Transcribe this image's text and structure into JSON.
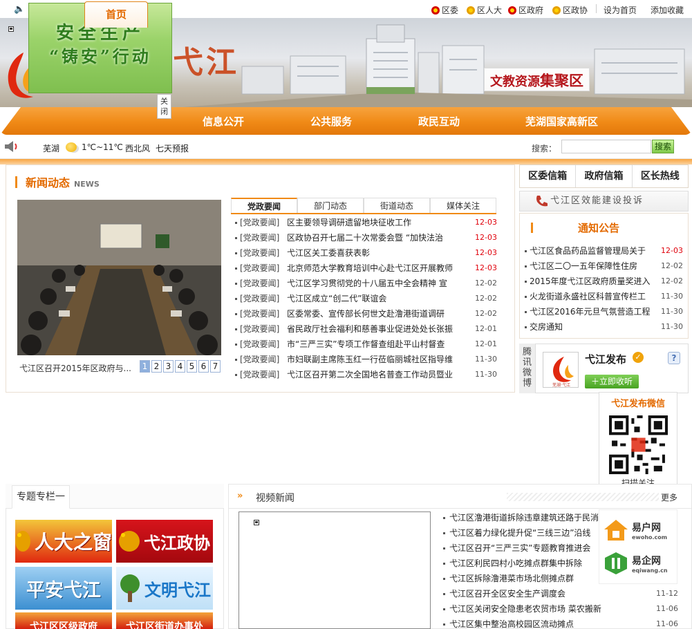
{
  "top_links": [
    {
      "label": "区委",
      "icon": "party-emblem-icon"
    },
    {
      "label": "区人大",
      "icon": "national-emblem-icon"
    },
    {
      "label": "区政府",
      "icon": "party-emblem-icon"
    },
    {
      "label": "区政协",
      "icon": "cppcc-emblem-icon"
    }
  ],
  "set_home_label": "设为首页",
  "add_favorite_label": "添加收藏",
  "banner": {
    "title_text": "弋江",
    "slogan_prefix": "文教资源",
    "slogan_highlight": "集聚区"
  },
  "float_ad": {
    "line1": "安全生产",
    "line2": "“铸安”行动",
    "close_label": "关闭"
  },
  "nav": {
    "home": "首页",
    "items": [
      "信息公开",
      "公共服务",
      "政民互动",
      "芜湖国家高新区"
    ]
  },
  "weather": {
    "city": "芜湖",
    "temp": "1℃~11℃",
    "wind": "西北风",
    "forecast_link": "七天预报"
  },
  "search": {
    "label": "搜索：",
    "button": "搜索",
    "value": ""
  },
  "news": {
    "title": "新闻动态",
    "subtitle": "NEWS",
    "photo_caption": "弋江区召开2015年区政府与...",
    "pages": [
      "1",
      "2",
      "3",
      "4",
      "5",
      "6",
      "7"
    ],
    "tabs": [
      "党政要闻",
      "部门动态",
      "街道动态",
      "媒体关注"
    ],
    "items": [
      {
        "cat": "[党政要闻]",
        "text": "区主要领导调研遗留地块征收工作",
        "date": "12-03",
        "red": true
      },
      {
        "cat": "[党政要闻]",
        "text": "区政协召开七届二十次常委会暨 “加快法治",
        "date": "12-03",
        "red": true
      },
      {
        "cat": "[党政要闻]",
        "text": "弋江区关工委喜获表彰",
        "date": "12-03",
        "red": true
      },
      {
        "cat": "[党政要闻]",
        "text": "北京师范大学教育培训中心赴弋江区开展教师",
        "date": "12-03",
        "red": true
      },
      {
        "cat": "[党政要闻]",
        "text": "弋江区学习贯彻党的十八届五中全会精神 宣",
        "date": "12-02",
        "red": false
      },
      {
        "cat": "[党政要闻]",
        "text": "弋江区成立“创二代”联谊会",
        "date": "12-02",
        "red": false
      },
      {
        "cat": "[党政要闻]",
        "text": "区委常委、宣传部长何世文赴澛港街道调研",
        "date": "12-02",
        "red": false
      },
      {
        "cat": "[党政要闻]",
        "text": "省民政厅社会福利和慈善事业促进处处长张振",
        "date": "12-01",
        "red": false
      },
      {
        "cat": "[党政要闻]",
        "text": "市“三严三实”专项工作督查组赴平山村督查",
        "date": "12-01",
        "red": false
      },
      {
        "cat": "[党政要闻]",
        "text": "市妇联副主席陈玉红一行莅临丽城社区指导维",
        "date": "11-30",
        "red": false
      },
      {
        "cat": "[党政要闻]",
        "text": "弋江区召开第二次全国地名普查工作动员暨业",
        "date": "11-30",
        "red": false
      }
    ]
  },
  "mailbox_tabs": [
    "区委信箱",
    "政府信箱",
    "区长热线"
  ],
  "complaint_banner": "弋江区效能建设投诉",
  "notice": {
    "title": "通知公告",
    "items": [
      {
        "text": "弋江区食品药品监督管理局关于",
        "date": "12-03",
        "red": true
      },
      {
        "text": "弋江区二〇一五年保障性住房",
        "date": "12-02",
        "red": false
      },
      {
        "text": "2015年度弋江区政府质量奖进入",
        "date": "12-02",
        "red": false
      },
      {
        "text": "火龙街道永盛社区科普宣传栏工",
        "date": "11-30",
        "red": false
      },
      {
        "text": "弋江区2016年元旦气氛营造工程",
        "date": "11-30",
        "red": false
      },
      {
        "text": "交房通知",
        "date": "11-30",
        "red": false
      }
    ]
  },
  "weibo": {
    "tab_label": "腾讯微博",
    "name": "弋江发布",
    "follow_button": "立即收听",
    "logo_text": "芜湖·弋江"
  },
  "wechat_qr": {
    "title": "弋江发布微信",
    "caption": "扫描关注"
  },
  "float_links": [
    {
      "name": "易户网",
      "url": "ewoho.com"
    },
    {
      "name": "易企网",
      "url": "eqiwang.cn"
    }
  ],
  "topics": {
    "tab_label": "专题专栏一",
    "items": [
      "人大之窗",
      "弋江政协",
      "平安弋江",
      "文明弋江",
      "弋江区区级政府",
      "弋江区街道办事处"
    ]
  },
  "video_news": {
    "title": "视频新闻",
    "more": "更多",
    "items": [
      {
        "text": "弋江区澛港街道拆除违章建筑还路于民消",
        "date": ""
      },
      {
        "text": "弋江区着力绿化提升促“三线三边”沿线",
        "date": ""
      },
      {
        "text": "弋江区召开“三严三实”专题教育推进会",
        "date": ""
      },
      {
        "text": "弋江区利民四村小吃摊点群集中拆除",
        "date": ""
      },
      {
        "text": "弋江区拆除澛港菜市场北侧摊点群",
        "date": ""
      },
      {
        "text": "弋江区召开全区安全生产调度会",
        "date": "11-12"
      },
      {
        "text": "弋江区关闭安全隐患老农贸市场 菜农搬新家",
        "date": "11-06"
      },
      {
        "text": "弋江区集中整治高校园区流动摊点",
        "date": "11-06"
      }
    ]
  }
}
